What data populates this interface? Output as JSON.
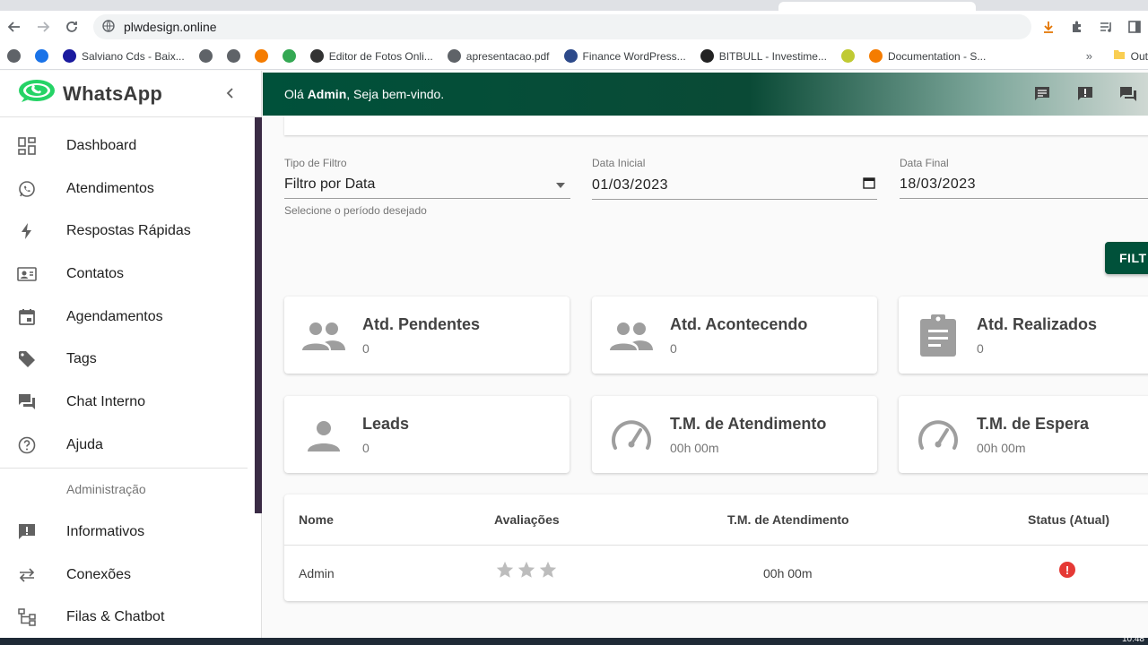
{
  "browser": {
    "url": "plwdesign.online",
    "bookmarks": [
      {
        "label": "",
        "color": "#5f6368"
      },
      {
        "label": "",
        "color": "#1a73e8"
      },
      {
        "label": "Salviano Cds - Baix...",
        "color": "#1a1a9e"
      },
      {
        "label": "",
        "color": "#5f6368"
      },
      {
        "label": "",
        "color": "#5f6368"
      },
      {
        "label": "",
        "color": "#f57c00"
      },
      {
        "label": "",
        "color": "#34a853"
      },
      {
        "label": "Editor de Fotos Onli...",
        "color": "#333333"
      },
      {
        "label": "apresentacao.pdf",
        "color": "#5f6368"
      },
      {
        "label": "Finance WordPress...",
        "color": "#2d4a8a"
      },
      {
        "label": "BITBULL - Investime...",
        "color": "#222222"
      },
      {
        "label": "",
        "color": "#c0ca33"
      },
      {
        "label": "Documentation - S...",
        "color": "#f57c00"
      }
    ],
    "more": "»",
    "folder": "Out"
  },
  "sidebar": {
    "logo": "WhatsApp",
    "items": [
      {
        "label": "Dashboard",
        "icon": "dashboard-icon"
      },
      {
        "label": "Atendimentos",
        "icon": "whatsapp-icon"
      },
      {
        "label": "Respostas Rápidas",
        "icon": "flash-icon"
      },
      {
        "label": "Contatos",
        "icon": "contacts-icon"
      },
      {
        "label": "Agendamentos",
        "icon": "calendar-icon"
      },
      {
        "label": "Tags",
        "icon": "tag-icon"
      },
      {
        "label": "Chat Interno",
        "icon": "forum-icon"
      },
      {
        "label": "Ajuda",
        "icon": "help-icon"
      }
    ],
    "section": "Administração",
    "admin_items": [
      {
        "label": "Informativos",
        "icon": "announcement-icon"
      },
      {
        "label": "Conexões",
        "icon": "sync-icon"
      },
      {
        "label": "Filas & Chatbot",
        "icon": "queue-icon"
      }
    ]
  },
  "header": {
    "greeting_prefix": "Olá ",
    "user": "Admin",
    "greeting_suffix": ", Seja bem-vindo."
  },
  "filters": {
    "type_label": "Tipo de Filtro",
    "type_value": "Filtro por Data",
    "helper": "Selecione o período desejado",
    "start_label": "Data Inicial",
    "start_value": "01/03/2023",
    "end_label": "Data Final",
    "end_value": "18/03/2023",
    "button": "FILT"
  },
  "cards": [
    {
      "title": "Atd. Pendentes",
      "value": "0",
      "icon": "people-icon"
    },
    {
      "title": "Atd. Acontecendo",
      "value": "0",
      "icon": "people-icon"
    },
    {
      "title": "Atd. Realizados",
      "value": "0",
      "icon": "clipboard-icon"
    },
    {
      "title": "Leads",
      "value": "0",
      "icon": "person-icon"
    },
    {
      "title": "T.M. de Atendimento",
      "value": "00h 00m",
      "icon": "speedometer-icon"
    },
    {
      "title": "T.M. de Espera",
      "value": "00h 00m",
      "icon": "speedometer-icon"
    }
  ],
  "table": {
    "headers": [
      "Nome",
      "Avaliações",
      "T.M. de Atendimento",
      "Status (Atual)"
    ],
    "rows": [
      {
        "name": "Admin",
        "rating": 0,
        "rating_max": 3,
        "time": "00h 00m",
        "status": "!"
      }
    ]
  },
  "taskbar": {
    "clock": "10:48"
  }
}
